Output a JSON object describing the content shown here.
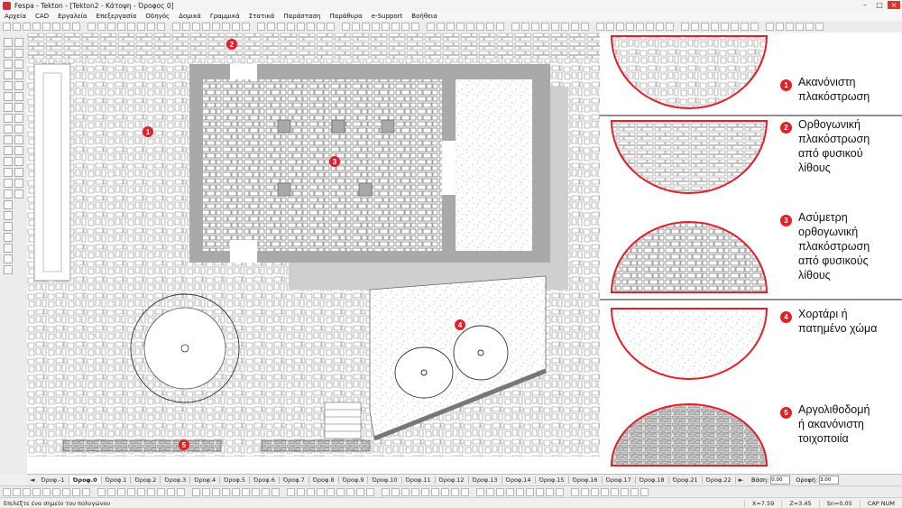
{
  "window": {
    "title": "Fespa - Tekton - [Tekton2 - Κάτοψη - Όροφος 0]"
  },
  "menu": [
    "Αρχεία",
    "CAD",
    "Εργαλεία",
    "Επεξεργασία",
    "Οδηγός",
    "Δομικά",
    "Γραμμικά",
    "Στατικά",
    "Παράσταση",
    "Παράθυρα",
    "e-Support",
    "Βοήθεια"
  ],
  "drawing": {
    "markers": [
      "1",
      "2",
      "3",
      "4",
      "5"
    ]
  },
  "legend": {
    "items": [
      {
        "num": "1",
        "lines": [
          "Ακανόνιστη",
          "πλακόστρωση"
        ]
      },
      {
        "num": "2",
        "lines": [
          "Ορθογωνική",
          "πλακόστρωση",
          "από φυσικού",
          "λίθους"
        ]
      },
      {
        "num": "3",
        "lines": [
          "Ασύμετρη",
          "ορθογωνική",
          "πλακόστρωση",
          "από φυσικούς",
          "λίθους"
        ]
      },
      {
        "num": "4",
        "lines": [
          "Χορτάρι ή",
          "πατημένο χώμα"
        ]
      },
      {
        "num": "5",
        "lines": [
          "Αργολιθοδομή",
          "ή ακανόνιστη",
          "τοιχοποιία"
        ]
      }
    ]
  },
  "tabs": {
    "items": [
      "Όροφ.-1",
      "Όροφ.0",
      "Όροφ.1",
      "Όροφ.2",
      "Όροφ.3",
      "Όροφ.4",
      "Όροφ.5",
      "Όροφ.6",
      "Όροφ.7",
      "Όροφ.8",
      "Όροφ.9",
      "Όροφ.10",
      "Όροφ.11",
      "Όροφ.12",
      "Όροφ.13",
      "Όροφ.14",
      "Όροφ.15",
      "Όροφ.16",
      "Όροφ.17",
      "Όροφ.18",
      "Όροφ.21",
      "Όροφ.22"
    ],
    "active": "Όροφ.0",
    "base_label": "Βάση:",
    "base_value": "0.00",
    "floor_label": "Οροφή:",
    "floor_value": "3.00"
  },
  "status": {
    "message": "Επιλέξτε ένα σημείο του πολυγώνου",
    "x": "X=7.59",
    "z": "Z=3.45",
    "snap": "Sn=0.05",
    "mode": "CAP NUM"
  },
  "colors": {
    "accent_red": "#e0202a",
    "wall_gray": "#a9a9a9",
    "shadow_gray": "#cfcfcf"
  }
}
